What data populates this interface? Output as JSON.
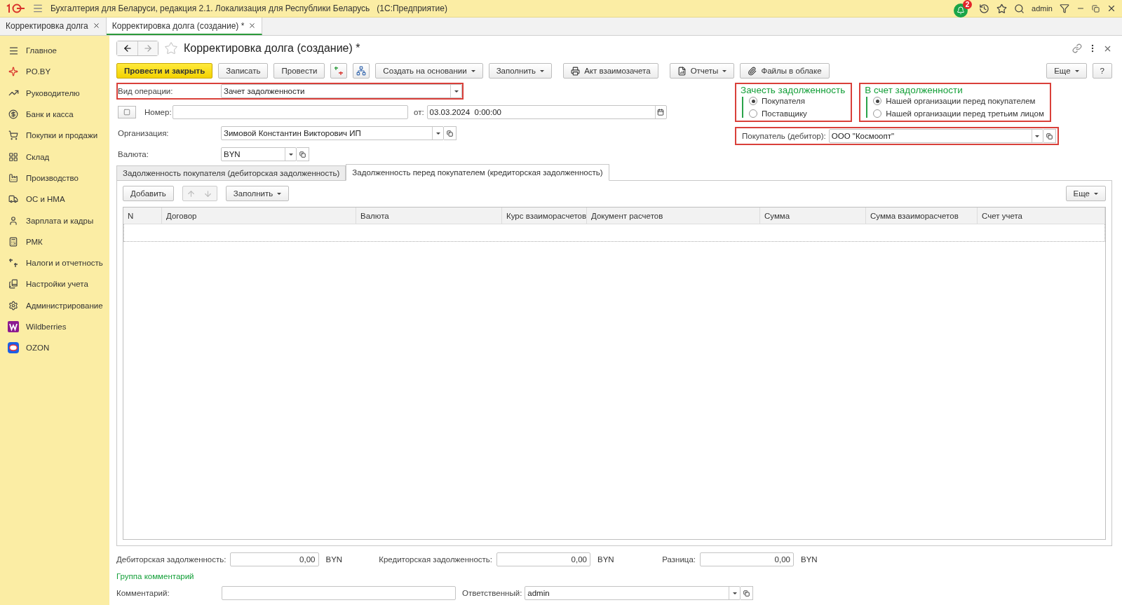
{
  "app_title": "Бухгалтерия для Беларуси, редакция 2.1. Локализация для Республики Беларусь   (1С:Предприятие)",
  "tray": {
    "notification_count": "2",
    "user": "admin"
  },
  "open_tabs": [
    {
      "label": "Корректировка долга",
      "selected": false
    },
    {
      "label": "Корректировка долга (создание) *",
      "selected": true
    }
  ],
  "sidebar": {
    "items": [
      {
        "label": "Главное"
      },
      {
        "label": "PO.BY"
      },
      {
        "label": "Руководителю"
      },
      {
        "label": "Банк и касса"
      },
      {
        "label": "Покупки и продажи"
      },
      {
        "label": "Склад"
      },
      {
        "label": "Производство"
      },
      {
        "label": "ОС и НМА"
      },
      {
        "label": "Зарплата и кадры"
      },
      {
        "label": "РМК"
      },
      {
        "label": "Налоги и отчетность"
      },
      {
        "label": "Настройки учета"
      },
      {
        "label": "Администрирование"
      },
      {
        "label": "Wildberries"
      },
      {
        "label": "OZON"
      }
    ]
  },
  "form": {
    "title": "Корректировка долга (создание) *",
    "toolbar": [
      {
        "kind": "primary",
        "label": "Провести и закрыть"
      },
      {
        "kind": "plain",
        "label": "Записать"
      },
      {
        "kind": "plain",
        "label": "Провести"
      },
      {
        "kind": "icon"
      },
      {
        "kind": "icon"
      },
      {
        "kind": "dropdown",
        "label": "Создать на основании"
      },
      {
        "kind": "dropdown",
        "label": "Заполнить"
      },
      {
        "kind": "print",
        "label": "Акт взаимозачета"
      },
      {
        "kind": "reports",
        "label": "Отчеты"
      },
      {
        "kind": "files",
        "label": "Файлы в облаке"
      }
    ],
    "more_button": "Еще",
    "help_button": "?",
    "operation": {
      "label": "Вид операции:",
      "value": "Зачет задолженности",
      "highlighted": true
    },
    "number": {
      "label": "Номер:"
    },
    "date": {
      "label": "от:",
      "value": "03.03.2024  0:00:00"
    },
    "organization": {
      "label": "Организация:",
      "value": "Зимовой Константин Викторович ИП"
    },
    "currency": {
      "label": "Валюта:",
      "value": "BYN"
    },
    "radio_groups": [
      {
        "title": "Зачесть задолженность",
        "highlighted": true,
        "options": [
          {
            "label": "Покупателя",
            "selected": true
          },
          {
            "label": "Поставщику",
            "selected": false
          }
        ]
      },
      {
        "title": "В счет задолженности",
        "highlighted": true,
        "options": [
          {
            "label": "Нашей организации перед покупателем",
            "selected": true
          },
          {
            "label": "Нашей организации перед третьим лицом",
            "selected": false
          }
        ]
      }
    ],
    "counterparty": {
      "label": "Покупатель (дебитор):",
      "value": "ООО \"Космоопт\"",
      "highlighted": true
    },
    "doc_tabs": [
      {
        "label": "Задолженность покупателя (дебиторская задолженность)",
        "selected": false
      },
      {
        "label": "Задолженность перед покупателем (кредиторская задолженность)",
        "selected": true
      }
    ],
    "table_toolbar": {
      "add": "Добавить",
      "fill": "Заполнить",
      "more": "Еще"
    },
    "table": {
      "columns": [
        "N",
        "Договор",
        "Валюта",
        "Курс взаиморасчетов",
        "Документ расчетов",
        "Сумма",
        "Сумма взаиморасчетов",
        "Счет учета"
      ]
    },
    "totals": [
      {
        "label": "Дебиторская задолженность:",
        "value": "0,00",
        "currency": "BYN"
      },
      {
        "label": "Кредиторская задолженность:",
        "value": "0,00",
        "currency": "BYN"
      },
      {
        "label": "Разница:",
        "value": "0,00",
        "currency": "BYN"
      }
    ],
    "comment_group": "Группа комментарий",
    "comment": {
      "label": "Комментарий:"
    },
    "responsible": {
      "label": "Ответственный:",
      "value": "admin"
    }
  }
}
